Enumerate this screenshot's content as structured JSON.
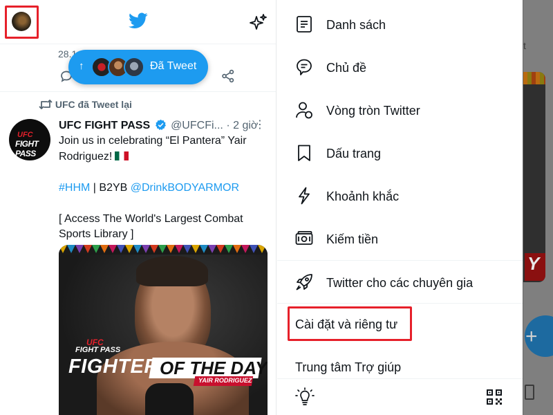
{
  "feed": {
    "previous_tweet_date": "28.1",
    "new_tweets_pill": {
      "label": "Đã Tweet",
      "arrow": "↑"
    },
    "retweet_context": "UFC đã Tweet lại",
    "tweet": {
      "author_name": "UFC FIGHT PASS",
      "handle": "@UFCFi...",
      "separator": "·",
      "time": "2 giờ",
      "more": "⋮",
      "avatar_line1": "UFC",
      "avatar_line2": "FIGHT PASS",
      "body_line1": "Join us in celebrating “El Pantera” Yair",
      "body_line2": "Rodriguez!",
      "hashtag": "#HHM",
      "body_mid": " | B2YB ",
      "mention": "@DrinkBODYARMOR",
      "body_line4": "[ Access The World's Largest Combat",
      "body_line5": "Sports Library ]",
      "media": {
        "brand_top": "UFC",
        "brand_sub": "FIGHT PASS",
        "headline_left": "FIGHTER",
        "headline_right": "OF THE DAY",
        "subline": "YAIR RODRIGUEZ"
      }
    }
  },
  "drawer": {
    "items": [
      {
        "label": "Danh sách",
        "icon": "list-icon"
      },
      {
        "label": "Chủ đề",
        "icon": "topics-icon"
      },
      {
        "label": "Vòng tròn Twitter",
        "icon": "twitter-circle-icon"
      },
      {
        "label": "Dấu trang",
        "icon": "bookmark-icon"
      },
      {
        "label": "Khoảnh khắc",
        "icon": "moments-icon"
      },
      {
        "label": "Kiếm tiền",
        "icon": "monetization-icon"
      },
      {
        "label": "Twitter cho các chuyên gia",
        "icon": "rocket-icon"
      }
    ],
    "settings_label": "Cài đặt và riêng tư",
    "help_label": "Trung tâm Trợ giúp",
    "bottom_icons": [
      "lightbulb-icon",
      "qr-code-icon"
    ]
  },
  "background": {
    "peek_text": "t",
    "peek_image_text": "Y"
  },
  "colors": {
    "twitter_blue": "#1d9bf0",
    "highlight_red": "#e6202a",
    "text_primary": "#0f1419",
    "text_secondary": "#536471"
  }
}
